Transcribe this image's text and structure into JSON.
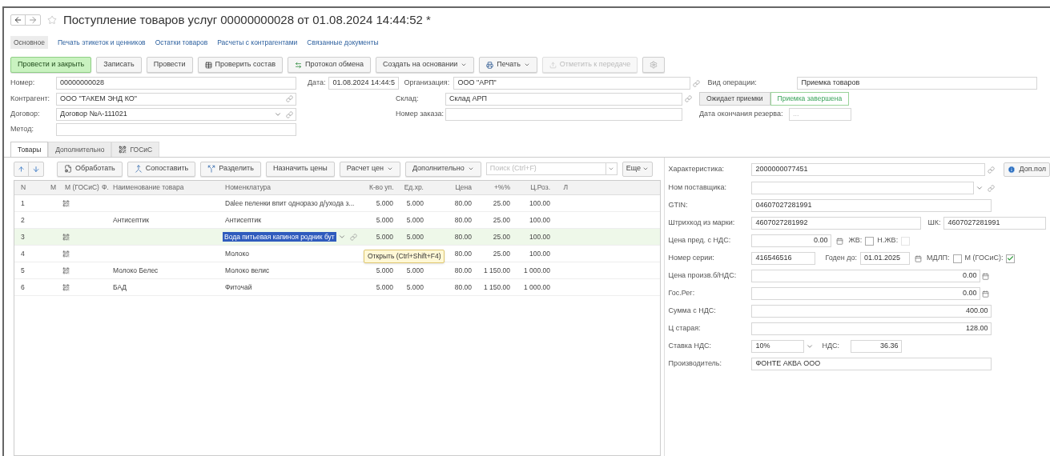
{
  "window": {
    "title": "Поступление товаров услуг 00000000028 от 01.08.2024 14:44:52 *"
  },
  "nav_links": [
    {
      "label": "Основное",
      "selected": true
    },
    {
      "label": "Печать этикеток и ценников",
      "selected": false
    },
    {
      "label": "Остатки товаров",
      "selected": false
    },
    {
      "label": "Расчеты с контрагентами",
      "selected": false
    },
    {
      "label": "Связанные документы",
      "selected": false
    }
  ],
  "toolbar": [
    {
      "label": "Провести и закрыть",
      "kind": "primary"
    },
    {
      "label": "Записать",
      "kind": "plain"
    },
    {
      "label": "Провести",
      "kind": "plain"
    },
    {
      "label": "Проверить состав",
      "kind": "grid"
    },
    {
      "label": "Протокол обмена",
      "kind": "exchange"
    },
    {
      "label": "Создать на основании",
      "kind": "menu"
    },
    {
      "label": "Печать",
      "kind": "print"
    },
    {
      "label": "Отметить к передаче",
      "kind": "disabled"
    },
    {
      "kind": "gear"
    }
  ],
  "header": {
    "number": {
      "label": "Номер:",
      "value": "00000000028"
    },
    "date": {
      "label": "Дата:",
      "value": "01.08.2024 14:44:5"
    },
    "organization": {
      "label": "Организация:",
      "value": "ООО \"АРП\""
    },
    "operation_type": {
      "label": "Вид операции:",
      "value": "Приемка товаров"
    },
    "counterparty": {
      "label": "Контрагент:",
      "value": "ООО \"ТАКЕМ ЭНД КО\""
    },
    "warehouse": {
      "label": "Склад:",
      "value": "Склад АРП"
    },
    "acceptance": [
      {
        "label": "Ожидает приемки",
        "selected": false
      },
      {
        "label": "Приемка завершена",
        "selected": true
      }
    ],
    "contract": {
      "label": "Договор:",
      "value": "Договор №А-111021"
    },
    "order_number": {
      "label": "Номер заказа:"
    },
    "reserve_end": {
      "label": "Дата окончания резерва:",
      "placeholder": "..."
    },
    "method": {
      "label": "Метод:"
    }
  },
  "tabs": [
    {
      "label": "Товары",
      "selected": true,
      "kind": "text"
    },
    {
      "label": "Дополнительно",
      "selected": false,
      "kind": "text"
    },
    {
      "label": "ГОСиС",
      "selected": false,
      "kind": "icon"
    }
  ],
  "table_toolbar": {
    "buttons": [
      {
        "label": "Обработать",
        "kind": "process"
      },
      {
        "label": "Сопоставить",
        "kind": "match"
      },
      {
        "label": "Разделить",
        "kind": "split"
      },
      {
        "label": "Назначить цены",
        "kind": "plain"
      },
      {
        "label": "Расчет цен",
        "kind": "menu"
      },
      {
        "label": "Дополнительно",
        "kind": "menu"
      }
    ],
    "search": {
      "placeholder": "Поиск (Ctrl+F)"
    },
    "more": "Еще"
  },
  "table": {
    "columns": [
      "N",
      "М",
      "М (ГОСиС)",
      "Ф.",
      "Наименование товара",
      "Номенклатура",
      "К-во уп.",
      "Ед.хр.",
      "Цена",
      "+%%",
      "Ц.Роз.",
      "Л"
    ],
    "rows": [
      {
        "n": "1",
        "marked": true,
        "name": "",
        "nomenclature": "Dalee пеленки впит одноразо д/ухода з...",
        "qty": "5.000",
        "unit": "5.000",
        "price": "80.00",
        "markup": "25.00",
        "retail": "100.00",
        "selected": false
      },
      {
        "n": "2",
        "marked": false,
        "name": "Антисептик",
        "nomenclature": "Антисептик",
        "qty": "5.000",
        "unit": "5.000",
        "price": "80.00",
        "markup": "25.00",
        "retail": "100.00",
        "selected": false
      },
      {
        "n": "3",
        "marked": true,
        "name": "",
        "nomenclature": "Вода питьевая капиноя родник бут",
        "qty": "5.000",
        "unit": "5.000",
        "price": "80.00",
        "markup": "25.00",
        "retail": "100.00",
        "selected": true
      },
      {
        "n": "4",
        "marked": true,
        "name": "",
        "nomenclature": "Молоко",
        "price": "80.00",
        "markup": "25.00",
        "retail": "100.00",
        "selected": false
      },
      {
        "n": "5",
        "marked": true,
        "name": "Молоко Белес",
        "nomenclature": "Молоко велис",
        "qty": "5.000",
        "unit": "5.000",
        "price": "80.00",
        "markup": "1 150.00",
        "retail": "1 000.00",
        "selected": false
      },
      {
        "n": "6",
        "marked": true,
        "name": "БАД",
        "nomenclature": "Фиточай",
        "qty": "5.000",
        "unit": "5.000",
        "price": "80.00",
        "markup": "1 150.00",
        "retail": "1 000.00",
        "selected": false
      }
    ]
  },
  "tooltip": "Открыть (Ctrl+Shift+F4)",
  "details": {
    "characteristic": {
      "label": "Характеристика:",
      "value": "2000000077451"
    },
    "extra_fields_button": "Доп.пол",
    "supplier_item": {
      "label": "Ном поставщика:"
    },
    "gtin": {
      "label": "GTIN:",
      "value": "04607027281991"
    },
    "mark_barcode": {
      "label": "Штрихкод из марки:",
      "value": "4607027281992"
    },
    "barcode": {
      "label": "ШК:",
      "value": "4607027281991"
    },
    "max_price": {
      "label": "Цена пред. с НДС:",
      "value": "0.00"
    },
    "vital": {
      "label": "ЖВ:",
      "checked": false
    },
    "non_vital": {
      "label": "Н.ЖВ:",
      "checked": false,
      "disabled": true
    },
    "serial": {
      "label": "Номер серии:",
      "value": "416546516"
    },
    "expiry": {
      "label": "Годен до:",
      "value": "01.01.2025"
    },
    "mdlp": {
      "label": "МДЛП:",
      "checked": false
    },
    "gosis": {
      "label": "М (ГОСиС):",
      "checked": true
    },
    "maker_price": {
      "label": "Цена произв.б/НДС:",
      "value": "0.00"
    },
    "gos_reg": {
      "label": "Гос.Рег:",
      "value": "0.00"
    },
    "sum_vat": {
      "label": "Сумма с НДС:",
      "value": "400.00"
    },
    "old_price": {
      "label": "Ц старая:",
      "value": "128.00"
    },
    "vat_rate": {
      "label": "Ставка НДС:",
      "value": "10%"
    },
    "vat": {
      "label": "НДС:",
      "value": "36.36"
    },
    "manufacturer": {
      "label": "Производитель:",
      "value": "ФОНТЕ АКВА ООО"
    }
  }
}
